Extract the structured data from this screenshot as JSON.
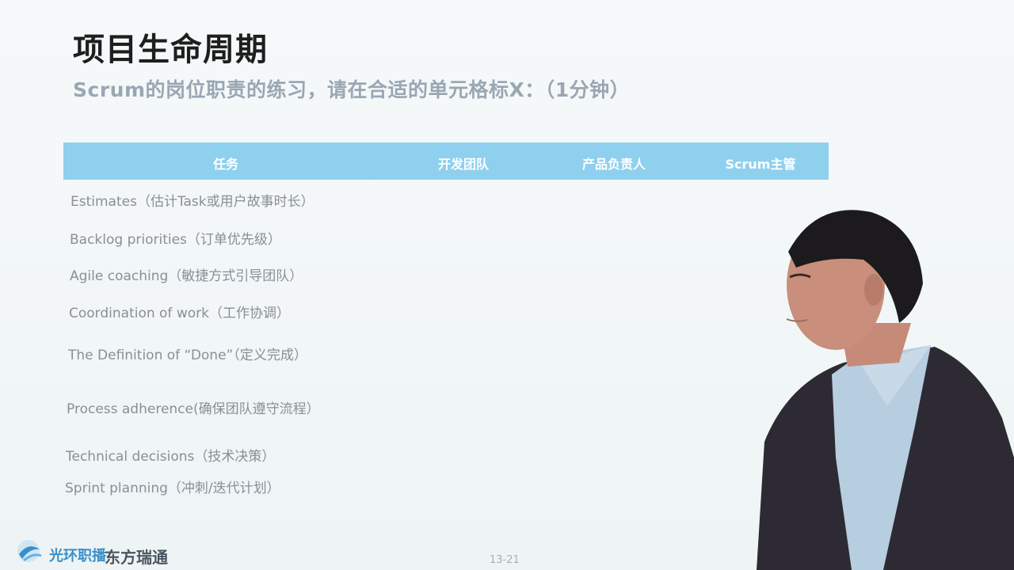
{
  "slide": {
    "title": "项目生命周期",
    "subtitle": "Scrum的岗位职责的练习，请在合适的单元格标X：（1分钟）",
    "table": {
      "headers": [
        "任务",
        "开发团队",
        "产品负责人",
        "Scrum主管"
      ],
      "rows": [
        "Estimates（估计Task或用户故事时长）",
        "Backlog priorities（订单优先级）",
        "Agile coaching（敏捷方式引导团队）",
        "Coordination of work（工作协调）",
        "The Definition of “Done”（定义完成）",
        "Process adherence(确保团队遵守流程）",
        "Technical decisions（技术决策）",
        "Sprint planning（冲刺/迭代计划）"
      ]
    },
    "footer": {
      "logo_left": "光环职播",
      "logo_right": "东方瑞通",
      "page": "13-21"
    }
  },
  "colors": {
    "header_bg": "#8fd0ee",
    "title": "#1e1e1e",
    "subtitle": "#9aa7b3",
    "row_text": "#8a8f96"
  }
}
